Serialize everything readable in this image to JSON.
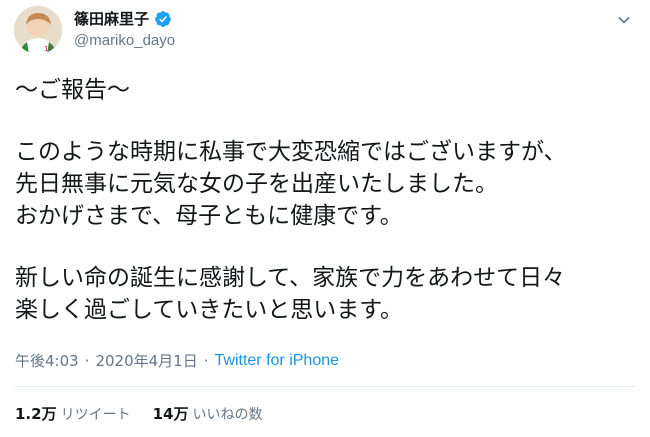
{
  "user": {
    "display_name": "篠田麻里子",
    "handle": "@mariko_dayo",
    "verified": true
  },
  "icons": {
    "verified": "verified-badge-icon",
    "menu": "chevron-down-icon"
  },
  "tweet": {
    "lines": [
      "〜ご報告〜",
      "",
      "このような時期に私事で大変恐縮ではございますが、",
      "先日無事に元気な女の子を出産いたしました。",
      "おかげさまで、母子ともに健康です。",
      "",
      "新しい命の誕生に感謝して、家族で力をあわせて日々",
      "楽しく過ごしていきたいと思います。"
    ]
  },
  "meta": {
    "time": "午後4:03",
    "separator": "·",
    "date": "2020年4月1日",
    "source": "Twitter for iPhone"
  },
  "stats": {
    "retweets_count": "1.2万",
    "retweets_label": "リツイート",
    "likes_count": "14万",
    "likes_label": "いいねの数"
  },
  "colors": {
    "text": "#14171a",
    "secondary": "#657786",
    "link": "#1b95e0",
    "verified": "#1da1f2",
    "divider": "#e6ecf0"
  }
}
